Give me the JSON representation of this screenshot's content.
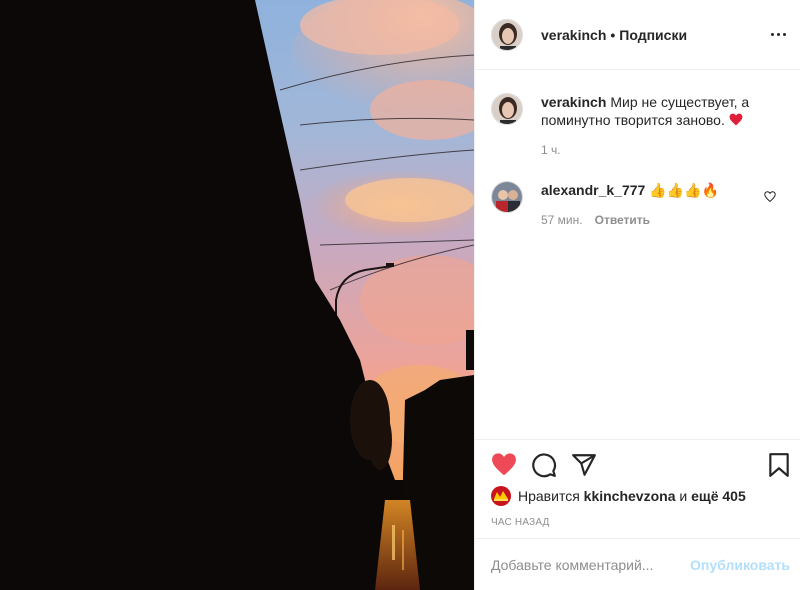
{
  "post": {
    "author": "verakinch",
    "follow_status": "Подписки",
    "caption": "Мир не существует, а поминутно творится заново.",
    "caption_emoji": "❤️",
    "caption_time": "1 ч."
  },
  "comments": [
    {
      "user": "alexandr_k_777",
      "text": "👍👍👍🔥",
      "time": "57 мин.",
      "reply_label": "Ответить"
    }
  ],
  "likes": {
    "prefix": "Нравится",
    "user": "kkinchevzona",
    "and_label": "и",
    "others": "ещё 405"
  },
  "posted_ago": "ЧАС НАЗАД",
  "comment_input": {
    "placeholder": "Добавьте комментарий...",
    "publish_label": "Опубликовать"
  },
  "icons": {
    "like": "heart-filled-icon",
    "comment": "comment-bubble-icon",
    "share": "paper-plane-icon",
    "save": "bookmark-icon",
    "more": "more-dots-icon",
    "comment_like": "heart-outline-icon"
  },
  "colors": {
    "like_red": "#ed4956",
    "publish_disabled": "#b2dffc",
    "text": "#262626",
    "muted": "#8e8e8e"
  }
}
